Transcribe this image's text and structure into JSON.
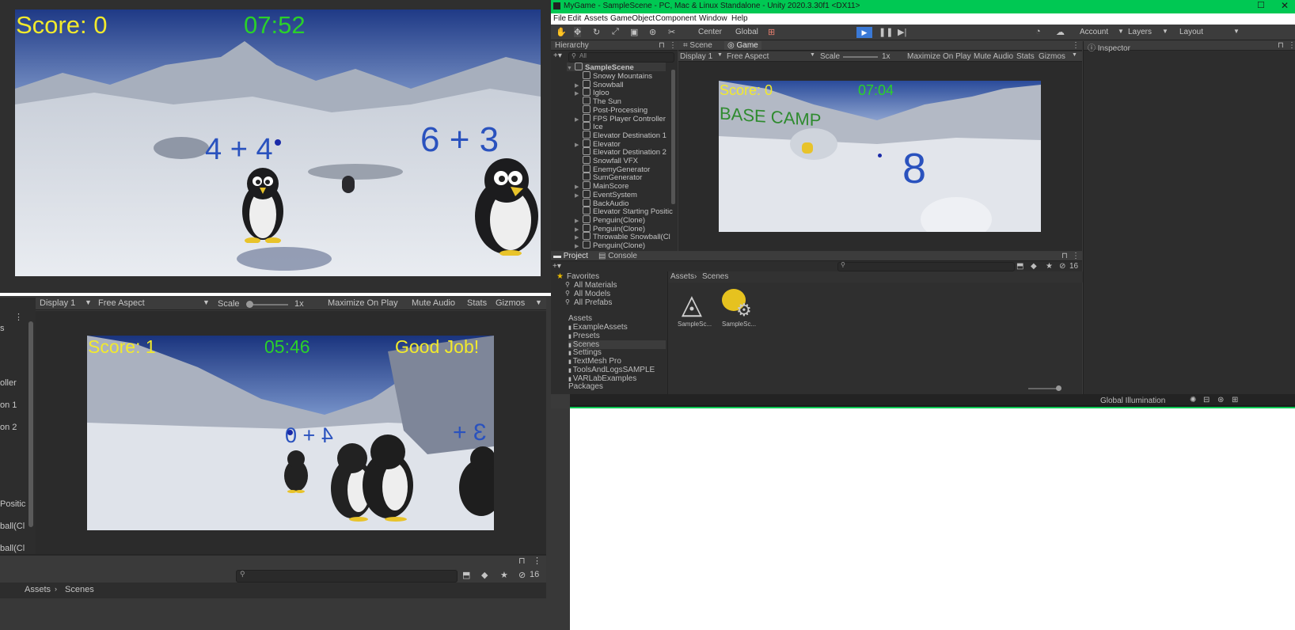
{
  "game_topleft": {
    "score": "Score: 0",
    "timer": "07:52",
    "problems": [
      "4 + 4",
      "6 + 3"
    ]
  },
  "game_bottom": {
    "score": "Score: 1",
    "timer": "05:46",
    "message": "Good Job!",
    "problems": [
      "4 + 0",
      "3 +"
    ]
  },
  "bottom_toolbar": {
    "display": "Display 1",
    "aspect": "Free Aspect",
    "scale_label": "Scale",
    "scale_value": "1x",
    "maximize": "Maximize On Play",
    "mute": "Mute Audio",
    "stats": "Stats",
    "gizmos": "Gizmos"
  },
  "bottom_hierarchy_fragments": [
    "s",
    "oller",
    "on 1",
    "on 2",
    "Positic",
    "ball(Cl",
    "ball(Cl"
  ],
  "bottom_project": {
    "hidden_count": "16",
    "breadcrumb": [
      "Assets",
      "Scenes"
    ]
  },
  "editor": {
    "title": "MyGame - SampleScene - PC, Mac & Linux Standalone - Unity 2020.3.30f1 <DX11>",
    "menu": [
      "File",
      "Edit",
      "Assets",
      "GameObject",
      "Component",
      "Window",
      "Help"
    ],
    "toolbar": {
      "center": "Center",
      "global": "Global",
      "account": "Account",
      "layers": "Layers",
      "layout": "Layout"
    },
    "hierarchy": {
      "tab": "Hierarchy",
      "search_prefix": "All",
      "scene": "SampleScene",
      "items": [
        {
          "label": "Snowy Mountains",
          "arrow": false
        },
        {
          "label": "Snowball",
          "arrow": true
        },
        {
          "label": "Igloo",
          "arrow": true
        },
        {
          "label": "The Sun",
          "arrow": false
        },
        {
          "label": "Post-Processing",
          "arrow": false
        },
        {
          "label": "FPS Player Controller",
          "arrow": true
        },
        {
          "label": "Ice",
          "arrow": false
        },
        {
          "label": "Elevator Destination 1",
          "arrow": false
        },
        {
          "label": "Elevator",
          "arrow": true
        },
        {
          "label": "Elevator Destination 2",
          "arrow": false
        },
        {
          "label": "Snowfall VFX",
          "arrow": false
        },
        {
          "label": "EnemyGenerator",
          "arrow": false
        },
        {
          "label": "SumGenerator",
          "arrow": false
        },
        {
          "label": "MainScore",
          "arrow": true
        },
        {
          "label": "EventSystem",
          "arrow": true
        },
        {
          "label": "BackAudio",
          "arrow": false
        },
        {
          "label": "Elevator Starting Positic",
          "arrow": false
        },
        {
          "label": "Penguin(Clone)",
          "arrow": true
        },
        {
          "label": "Penguin(Clone)",
          "arrow": true
        },
        {
          "label": "Throwable Snowball(Cl",
          "arrow": true
        },
        {
          "label": "Penguin(Clone)",
          "arrow": true
        }
      ]
    },
    "scene_tab": "Scene",
    "game_tab": "Game",
    "inspector_tab": "Inspector",
    "game_toolbar": {
      "display": "Display 1",
      "aspect": "Free Aspect",
      "scale_label": "Scale",
      "scale_value": "1x",
      "maximize": "Maximize On Play",
      "mute": "Mute Audio",
      "stats": "Stats",
      "gizmos": "Gizmos"
    },
    "game_view": {
      "score": "Score: 0",
      "timer": "07:04",
      "sign": "BASE CAMP",
      "number": "8"
    },
    "project": {
      "tab": "Project",
      "console_tab": "Console",
      "hidden_count": "16",
      "favorites": "Favorites",
      "favorite_items": [
        "All Materials",
        "All Models",
        "All Prefabs"
      ],
      "assets": "Assets",
      "asset_folders": [
        "ExampleAssets",
        "Presets",
        "Scenes",
        "Settings",
        "TextMesh Pro",
        "ToolsAndLogsSAMPLE",
        "VARLabExamples"
      ],
      "packages": "Packages",
      "breadcrumb": [
        "Assets",
        "Scenes"
      ],
      "files": [
        "SampleSc...",
        "SampleSc..."
      ]
    },
    "status": {
      "label": "Global Illumination"
    }
  },
  "colors": {
    "hud_yellow": "#f2ea2c",
    "hud_green": "#2ad12a",
    "problem_blue": "#2a52be",
    "title_green": "#00c853",
    "play_blue": "#3a79d6",
    "unity_dark": "#383838"
  }
}
